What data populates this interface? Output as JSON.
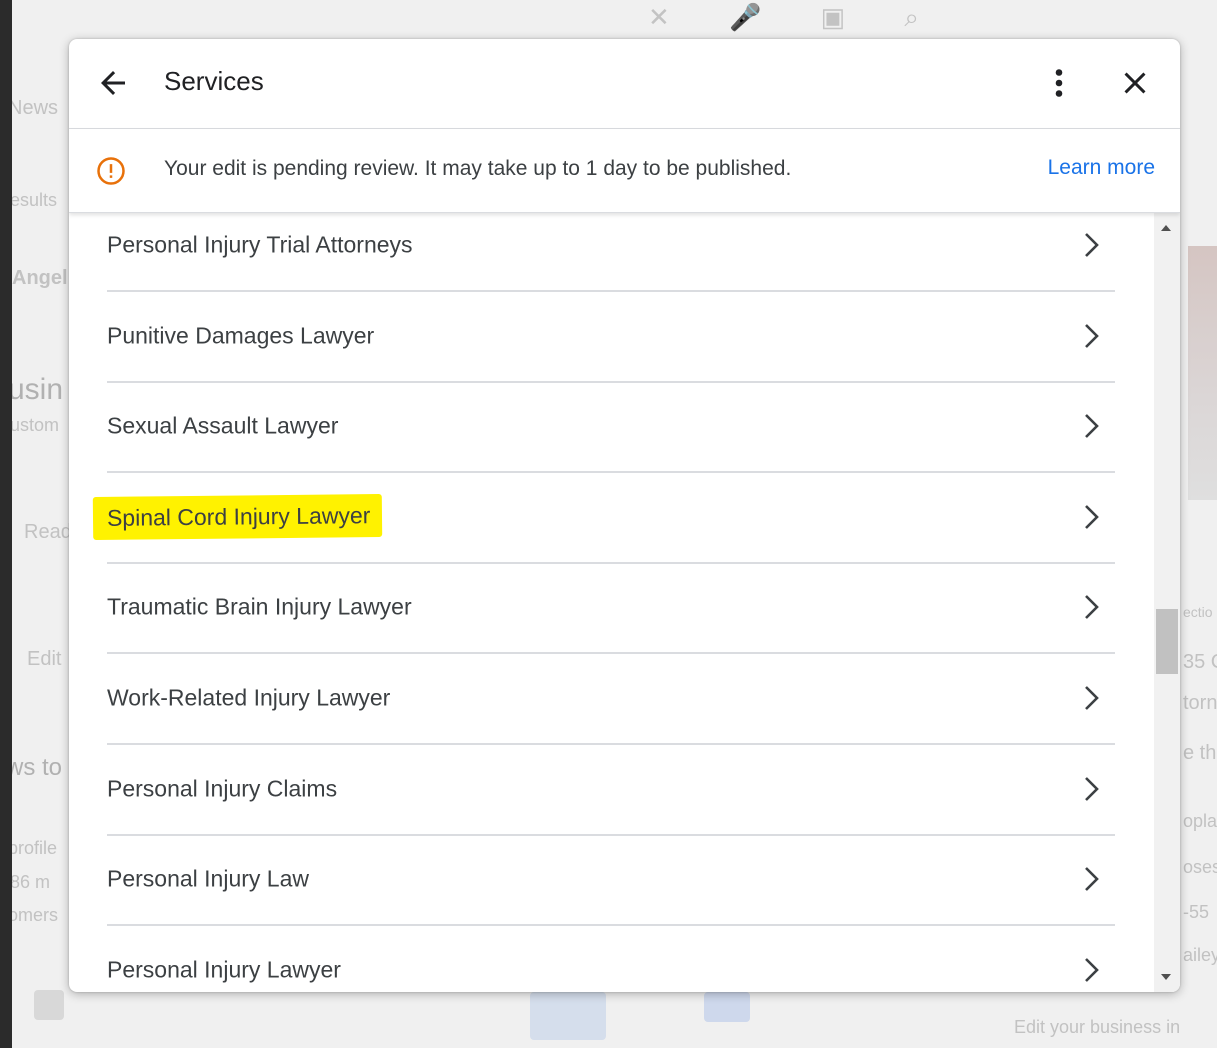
{
  "background": {
    "left_fragments": [
      "News",
      "esults",
      "Angel",
      "usin",
      "ustom",
      "Read",
      "Edit",
      "ws to",
      "profile",
      "86 m",
      "omers"
    ],
    "right_fragments": [
      "ectio",
      "35 C",
      "torn",
      "e thi",
      "opla",
      "oses",
      "-55",
      "ailey"
    ],
    "footer_text": "Edit your business in"
  },
  "dialog": {
    "title": "Services",
    "notice": {
      "text": "Your edit is pending review. It may take up to 1 day to be published.",
      "link": "Learn more",
      "icon": "warning-circle-icon",
      "icon_color": "#e8710a"
    },
    "services": [
      {
        "label": "Personal Injury Trial Attorneys",
        "highlighted": false
      },
      {
        "label": "Punitive Damages Lawyer",
        "highlighted": false
      },
      {
        "label": "Sexual Assault Lawyer",
        "highlighted": false
      },
      {
        "label": "Spinal Cord Injury Lawyer",
        "highlighted": true
      },
      {
        "label": "Traumatic Brain Injury Lawyer",
        "highlighted": false
      },
      {
        "label": "Work-Related Injury Lawyer",
        "highlighted": false
      },
      {
        "label": "Personal Injury Claims",
        "highlighted": false
      },
      {
        "label": "Personal Injury Law",
        "highlighted": false
      },
      {
        "label": "Personal Injury Lawyer",
        "highlighted": false
      }
    ]
  },
  "colors": {
    "highlight": "#fff200",
    "link": "#1a73e8",
    "text": "#3c4043"
  }
}
